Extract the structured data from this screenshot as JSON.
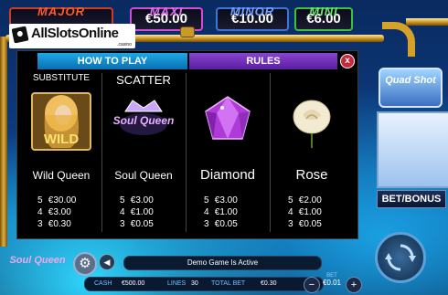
{
  "jackpots": {
    "major": {
      "name": "MAJOR",
      "value": ""
    },
    "maxi": {
      "name": "MAXI",
      "value": "€50.00"
    },
    "minor": {
      "name": "MINOR",
      "value": "€10.00"
    },
    "mini": {
      "name": "MINI",
      "value": "€6.00"
    }
  },
  "watermark": {
    "text": "AllSlotsOnline",
    "sub": ".casino"
  },
  "side": {
    "logo": "Quad Shot",
    "bet_bonus": "BET/BONUS"
  },
  "help": {
    "tabs": [
      "HOW TO PLAY",
      "RULES"
    ],
    "close_label": "x",
    "columns": [
      {
        "header": "SUBSTITUTE",
        "symbol_text": "WILD",
        "name": "Wild Queen",
        "pays": [
          {
            "count": "5",
            "amount": "€30.00"
          },
          {
            "count": "4",
            "amount": "€3.00"
          },
          {
            "count": "3",
            "amount": "€0.30"
          }
        ]
      },
      {
        "header": "SCATTER",
        "symbol_text": "Soul Queen",
        "name": "Soul Queen",
        "pays": [
          {
            "count": "5",
            "amount": "€3.00"
          },
          {
            "count": "4",
            "amount": "€1.00"
          },
          {
            "count": "3",
            "amount": "€0.05"
          }
        ]
      },
      {
        "header": "",
        "symbol_text": "",
        "name": "Diamond",
        "pays": []
      },
      {
        "header": "",
        "symbol_text": "",
        "name": "Rose",
        "pays": []
      }
    ]
  },
  "bottom": {
    "logo": "Soul Queen",
    "demo_message": "Demo Game Is Active",
    "cash_label": "CASH",
    "cash_value": "€500.00",
    "lines_label": "LINES",
    "lines_value": "30",
    "total_bet_label": "TOTAL BET",
    "total_bet_value": "€0.30",
    "bet_label": "BET",
    "bet_value": "€0.01",
    "minus": "−",
    "plus": "+"
  },
  "colors": {
    "major": "#ff5a2a",
    "maxi": "#e46cf0",
    "minor": "#6fa0ff",
    "mini": "#6fe36f",
    "tab_how": "#1ea8e6",
    "tab_rules": "#8844d0"
  }
}
